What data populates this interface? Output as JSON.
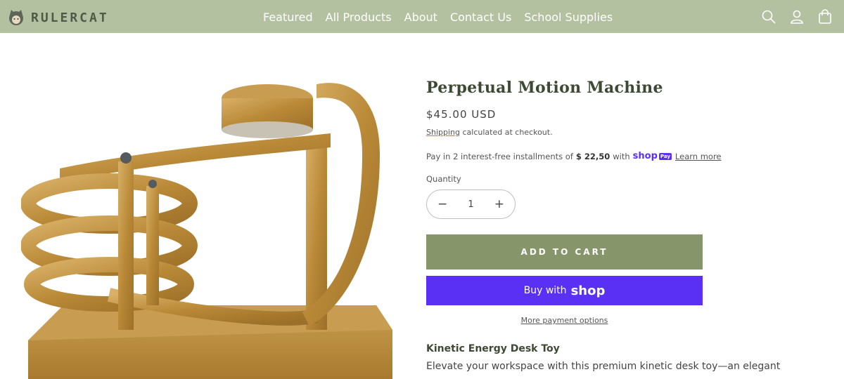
{
  "brand": {
    "name": "RULERCAT"
  },
  "nav": {
    "items": [
      "Featured",
      "All Products",
      "About",
      "Contact Us",
      "School Supplies"
    ]
  },
  "header_icons": [
    "search-icon",
    "account-icon",
    "cart-icon"
  ],
  "product": {
    "title": "Perpetual Motion Machine",
    "price": "$45.00 USD",
    "shipping_link": "Shipping",
    "shipping_text": " calculated at checkout.",
    "installments_prefix": "Pay in 2 interest-free installments of",
    "installment_amount": "$ 22,50",
    "installments_with": "with",
    "shop_logo": "shop",
    "shop_pay_badge": "Pay",
    "learn_more": "Learn more",
    "quantity_label": "Quantity",
    "quantity_value": "1",
    "quantity_minus": "−",
    "quantity_plus": "+",
    "add_to_cart": "ADD TO CART",
    "buy_with": "Buy with",
    "buy_shop_word": "shop",
    "more_payment": "More payment options",
    "description_heading": "Kinetic Energy Desk Toy",
    "description_text": "Elevate your workspace with this premium kinetic desk toy—an elegant"
  },
  "colors": {
    "header_bg": "#b3c1a0",
    "add_to_cart_bg": "#86966a",
    "shop_purple": "#5a31f4"
  }
}
